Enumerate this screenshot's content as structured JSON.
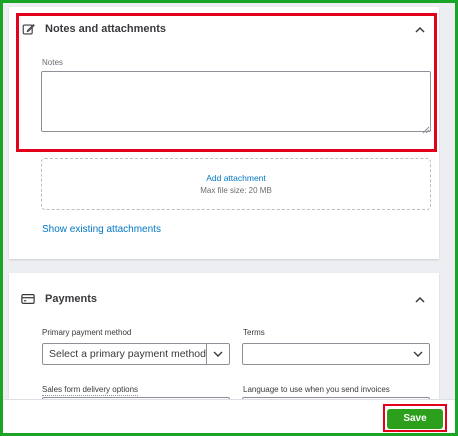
{
  "notes_section": {
    "title": "Notes and attachments",
    "notes_label": "Notes",
    "notes_value": "",
    "add_attachment": "Add attachment",
    "max_file_size": "Max file size: 20 MB",
    "show_existing": "Show existing attachments"
  },
  "payments_section": {
    "title": "Payments",
    "primary_payment_label": "Primary payment method",
    "primary_payment_value": "Select a primary payment method",
    "terms_label": "Terms",
    "terms_value": "",
    "delivery_options_label": "Sales form delivery options",
    "language_label": "Language to use when you send invoices"
  },
  "footer": {
    "save_label": "Save"
  },
  "colors": {
    "accent_green": "#2ca01c",
    "frame_green": "#1aa526",
    "highlight_red": "#e3001b",
    "link_blue": "#0077c5"
  },
  "icons": {
    "notes": "edit-note-icon",
    "payments": "payment-card-icon",
    "collapse": "chevron-up-icon",
    "dropdown": "chevron-down-icon"
  }
}
